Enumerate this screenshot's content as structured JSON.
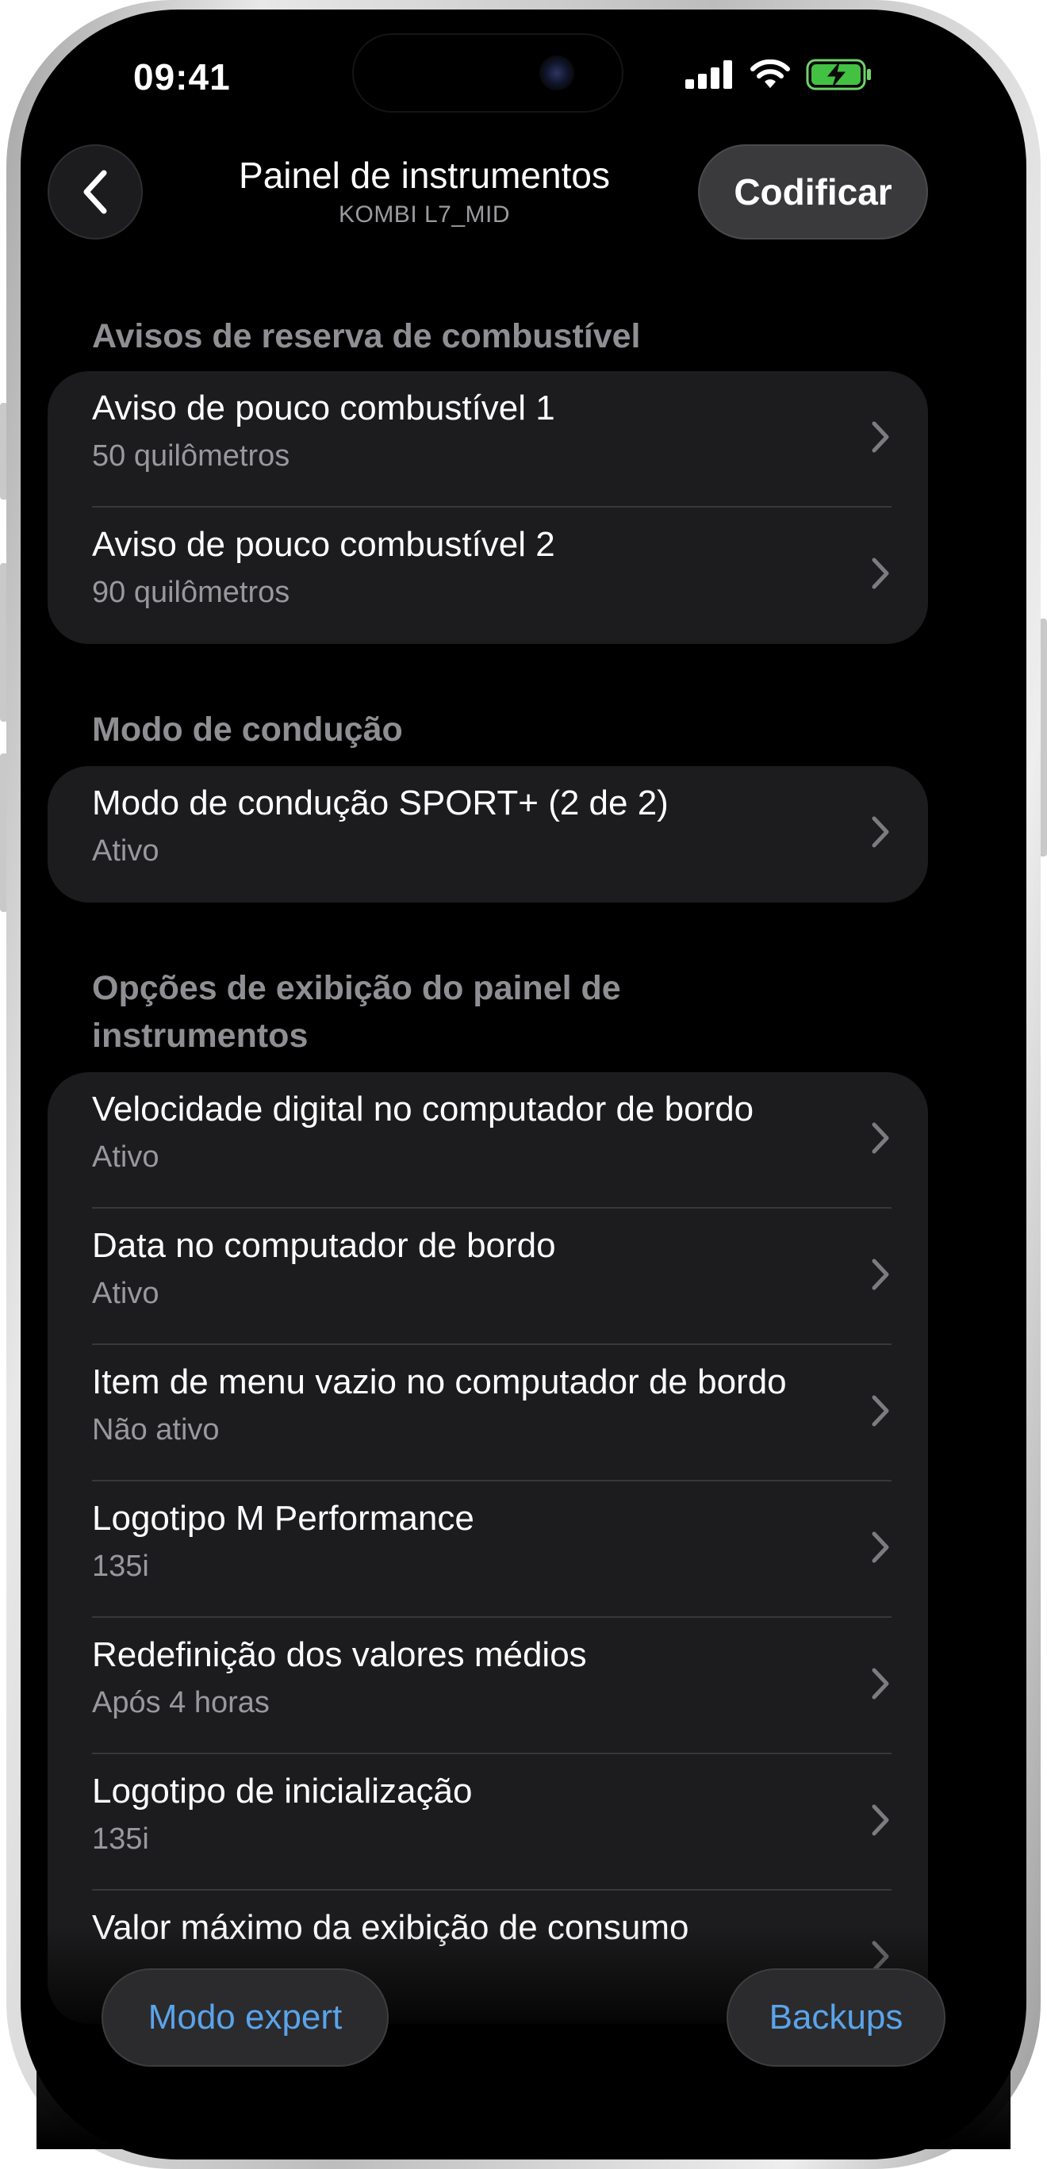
{
  "status_bar": {
    "time": "09:41"
  },
  "nav": {
    "title": "Painel de instrumentos",
    "subtitle": "KOMBI L7_MID",
    "code_button": "Codificar"
  },
  "sections": [
    {
      "header": "Avisos de reserva de combustível",
      "rows": [
        {
          "title": "Aviso de pouco combustível 1",
          "value": "50 quilômetros"
        },
        {
          "title": "Aviso de pouco combustível 2",
          "value": "90 quilômetros"
        }
      ]
    },
    {
      "header": "Modo de condução",
      "rows": [
        {
          "title": "Modo de condução SPORT+ (2 de 2)",
          "value": "Ativo"
        }
      ]
    },
    {
      "header_lines": [
        "Opções de exibição do painel de",
        "instrumentos"
      ],
      "rows": [
        {
          "title": "Velocidade digital no computador de bordo",
          "value": "Ativo"
        },
        {
          "title": "Data no computador de bordo",
          "value": "Ativo"
        },
        {
          "title": "Item de menu vazio no computador de bordo",
          "value": "Não ativo"
        },
        {
          "title": "Logotipo M Performance",
          "value": "135i"
        },
        {
          "title": "Redefinição dos valores médios",
          "value": "Após 4 horas"
        },
        {
          "title": "Logotipo de inicialização",
          "value": "135i"
        },
        {
          "title": "Valor máximo da exibição de consumo",
          "value": ""
        }
      ]
    }
  ],
  "bottom": {
    "expert_button": "Modo expert",
    "backups_button": "Backups"
  },
  "colors": {
    "background": "#000000",
    "card": "#1c1c1e",
    "accent": "#5aa4ea",
    "secondary_text": "#98989d"
  }
}
